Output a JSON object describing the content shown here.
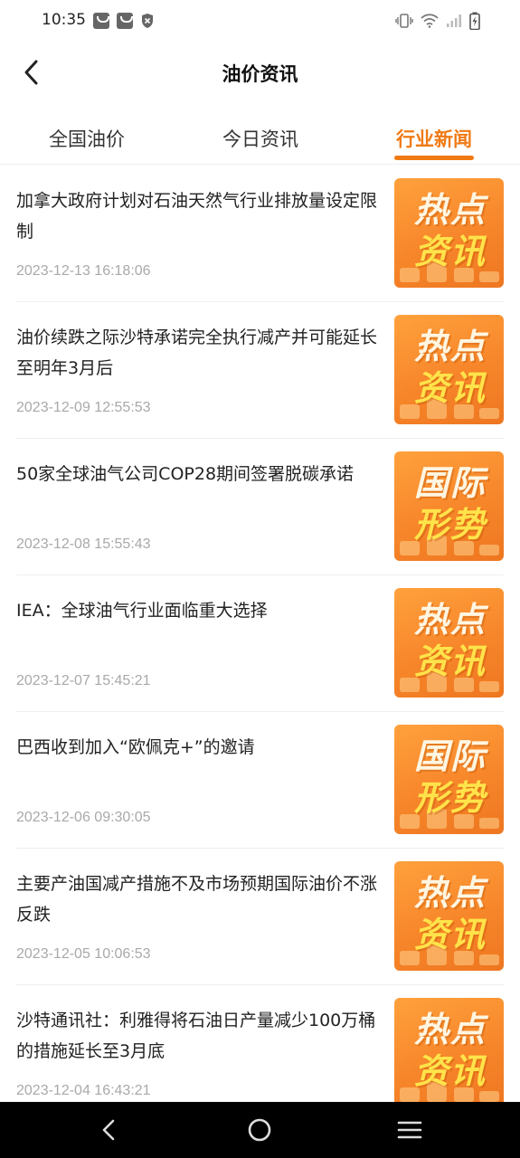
{
  "status_bar": {
    "time": "10:35",
    "left_icons": [
      "bag-notification-icon",
      "bag-notification-icon",
      "shield-notification-icon"
    ],
    "right_icons": [
      "vibrate-icon",
      "wifi-icon",
      "signal-icon",
      "battery-charging-icon"
    ]
  },
  "header": {
    "back_icon": "chevron-left-icon",
    "title": "油价资讯"
  },
  "tabs": [
    {
      "label": "全国油价",
      "active": false
    },
    {
      "label": "今日资讯",
      "active": false
    },
    {
      "label": "行业新闻",
      "active": true
    }
  ],
  "colors": {
    "accent": "#f07a14",
    "date_text": "#a9a9a9",
    "thumb_bg": "#f7862a",
    "thumb_highlight": "#ffe34a"
  },
  "news": [
    {
      "title": "加拿大政府计划对石油天然气行业排放量设定限制",
      "date": "2023-12-13 16:18:06",
      "thumb_line1": "热点",
      "thumb_line2": "资讯"
    },
    {
      "title": "油价续跌之际沙特承诺完全执行减产并可能延长至明年3月后",
      "date": "2023-12-09 12:55:53",
      "thumb_line1": "热点",
      "thumb_line2": "资讯"
    },
    {
      "title": "50家全球油气公司COP28期间签署脱碳承诺",
      "date": "2023-12-08 15:55:43",
      "thumb_line1": "国际",
      "thumb_line2": "形势"
    },
    {
      "title": "IEA：全球油气行业面临重大选择",
      "date": "2023-12-07 15:45:21",
      "thumb_line1": "热点",
      "thumb_line2": "资讯"
    },
    {
      "title": "巴西收到加入“欧佩克+”的邀请",
      "date": "2023-12-06 09:30:05",
      "thumb_line1": "国际",
      "thumb_line2": "形势"
    },
    {
      "title": "主要产油国减产措施不及市场预期国际油价不涨反跌",
      "date": "2023-12-05 10:06:53",
      "thumb_line1": "热点",
      "thumb_line2": "资讯"
    },
    {
      "title": "沙特通讯社：利雅得将石油日产量减少100万桶的措施延长至3月底",
      "date": "2023-12-04 16:43:21",
      "thumb_line1": "热点",
      "thumb_line2": "资讯"
    }
  ],
  "nav_bar": {
    "icons": [
      "back-nav-icon",
      "home-nav-icon",
      "menu-nav-icon"
    ]
  }
}
